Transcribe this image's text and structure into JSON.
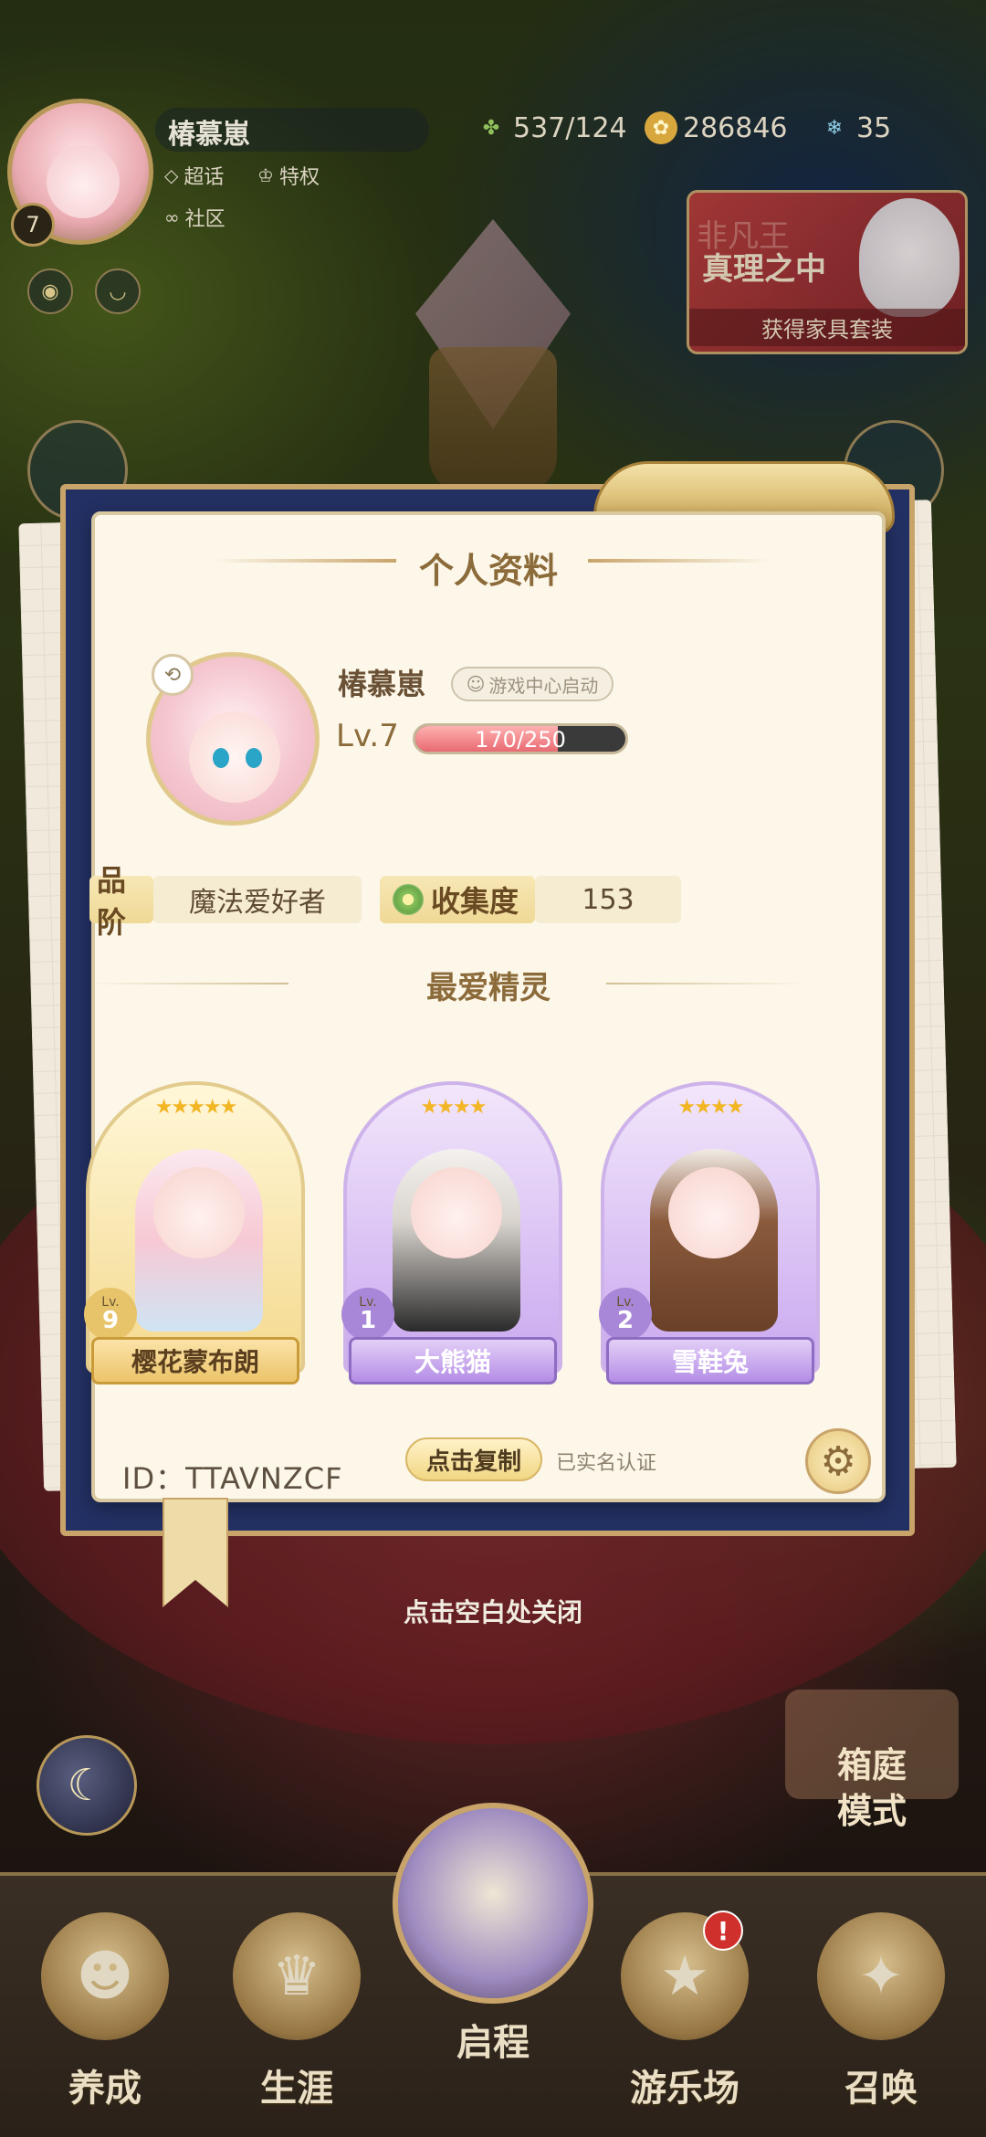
{
  "top_bar": {
    "player_name": "椿慕崽",
    "level_badge": "7",
    "tags": [
      "超话",
      "特权",
      "社区"
    ],
    "resources": {
      "stamina": "537/124",
      "gold": "286846",
      "gems": "35"
    },
    "event_banner": {
      "faded_text": "非凡王",
      "title": "真理之中",
      "subtitle": "获得家具套装"
    }
  },
  "modal": {
    "title": "个人资料",
    "profile": {
      "name": "椿慕崽",
      "launch_badge": "游戏中心启动",
      "level_label": "Lv.7",
      "xp_text": "170/250",
      "xp_progress": 0.68
    },
    "rank": {
      "label": "品阶",
      "value": "魔法爱好者"
    },
    "collection": {
      "label": "收集度",
      "value": "153"
    },
    "favorites_title": "最爱精灵",
    "favorites": [
      {
        "name": "樱花蒙布朗",
        "level": "9",
        "lv_label": "Lv.",
        "stars": "★★★★★",
        "style": "gold"
      },
      {
        "name": "大熊猫",
        "level": "1",
        "lv_label": "Lv.",
        "stars": "★★★★",
        "style": "purple"
      },
      {
        "name": "雪鞋兔",
        "level": "2",
        "lv_label": "Lv.",
        "stars": "★★★★",
        "style": "purple"
      }
    ],
    "id_text": "ID：TTAVNZCF",
    "copy_button": "点击复制",
    "verified_text": "已实名认证"
  },
  "close_hint": "点击空白处关闭",
  "garden_mode": "箱庭\n模式",
  "bottom_nav": {
    "items": [
      "养成",
      "生涯",
      "启程",
      "游乐场",
      "召唤"
    ],
    "notification": "!"
  },
  "colors": {
    "accent_gold": "#c9a46a",
    "navy_frame": "#233063",
    "card_bg": "#fcf7e9"
  }
}
